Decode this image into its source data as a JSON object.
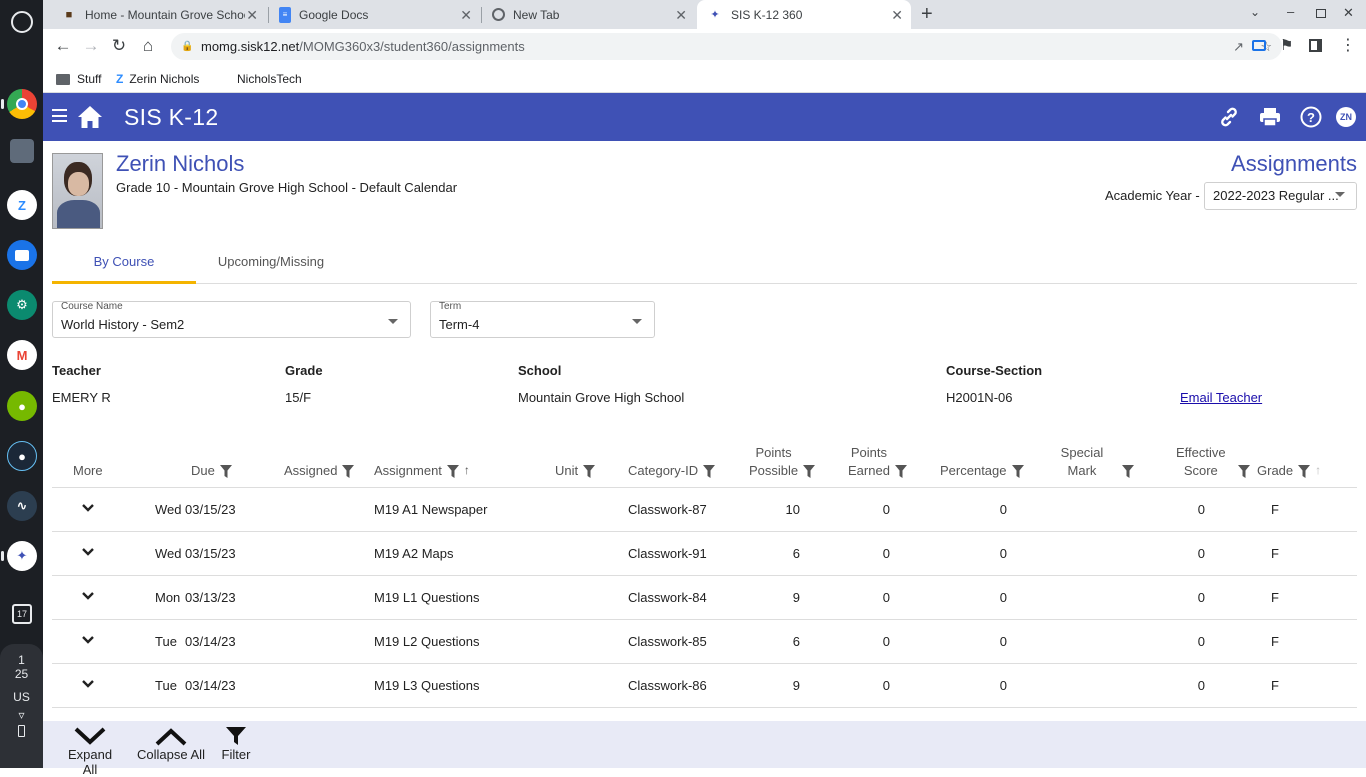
{
  "shelf": {
    "apps": [
      "chrome-icon",
      "virtual-machine-icon",
      "zoom-icon",
      "files-icon",
      "settings-icon",
      "gmail-icon",
      "nvidia-icon",
      "steam-icon",
      "analytics-icon",
      "sis-icon"
    ],
    "status": {
      "calendar_day": "17",
      "time_hour": "1",
      "time_min": "25",
      "locale": "US"
    }
  },
  "browser": {
    "tabs": [
      {
        "title": "Home - Mountain Grove Schools"
      },
      {
        "title": "Google Docs"
      },
      {
        "title": "New Tab"
      },
      {
        "title": "SIS K-12 360"
      }
    ],
    "url_host": "momg.sisk12.net",
    "url_path": "/MOMG360x3/student360/assignments",
    "bookmarks": [
      "Stuff",
      "Zerin Nichols",
      "NicholsTech"
    ]
  },
  "app": {
    "title": "SIS K-12",
    "user_initials": "ZN"
  },
  "student": {
    "name": "Zerin Nichols",
    "subtitle": "Grade 10 - Mountain Grove High School - Default Calendar"
  },
  "page": {
    "heading": "Assignments",
    "academic_year_label": "Academic Year -",
    "academic_year_value": "2022-2023 Regular ..."
  },
  "tabs": [
    {
      "label": "By Course"
    },
    {
      "label": "Upcoming/Missing"
    }
  ],
  "filters": {
    "course_label": "Course Name",
    "course_value": "World History - Sem2",
    "term_label": "Term",
    "term_value": "Term-4"
  },
  "course_info": {
    "teacher_h": "Teacher",
    "teacher": "EMERY R",
    "grade_h": "Grade",
    "grade": "15/F",
    "school_h": "School",
    "school": "Mountain Grove High School",
    "section_h": "Course-Section",
    "section": "H2001N-06",
    "email_link": "Email Teacher"
  },
  "table": {
    "headers": {
      "more": "More",
      "due": "Due",
      "assigned": "Assigned",
      "assignment": "Assignment",
      "unit": "Unit",
      "category": "Category-ID",
      "points_possible_1": "Points",
      "points_possible_2": "Possible",
      "points_earned_1": "Points",
      "points_earned_2": "Earned",
      "percentage": "Percentage",
      "special_1": "Special",
      "special_2": "Mark",
      "effective_1": "Effective",
      "effective_2": "Score",
      "grade": "Grade"
    },
    "rows": [
      {
        "day": "Wed",
        "date": "03/15/23",
        "assignment": "M19 A1 Newspaper",
        "category": "Classwork-87",
        "possible": "10",
        "earned": "0",
        "percentage": "0",
        "effective": "0",
        "grade": "F"
      },
      {
        "day": "Wed",
        "date": "03/15/23",
        "assignment": "M19 A2 Maps",
        "category": "Classwork-91",
        "possible": "6",
        "earned": "0",
        "percentage": "0",
        "effective": "0",
        "grade": "F"
      },
      {
        "day": "Mon",
        "date": "03/13/23",
        "assignment": "M19 L1 Questions",
        "category": "Classwork-84",
        "possible": "9",
        "earned": "0",
        "percentage": "0",
        "effective": "0",
        "grade": "F"
      },
      {
        "day": "Tue",
        "date": "03/14/23",
        "assignment": "M19 L2 Questions",
        "category": "Classwork-85",
        "possible": "6",
        "earned": "0",
        "percentage": "0",
        "effective": "0",
        "grade": "F"
      },
      {
        "day": "Tue",
        "date": "03/14/23",
        "assignment": "M19 L3 Questions",
        "category": "Classwork-86",
        "possible": "9",
        "earned": "0",
        "percentage": "0",
        "effective": "0",
        "grade": "F"
      }
    ]
  },
  "bottom_bar": {
    "expand_all": "Expand All",
    "collapse_all": "Collapse All",
    "filter": "Filter"
  },
  "colors": {
    "app_bar": "#3f51b5",
    "tab_indicator": "#f4b400",
    "bottom_bar": "#e8eaf6"
  }
}
